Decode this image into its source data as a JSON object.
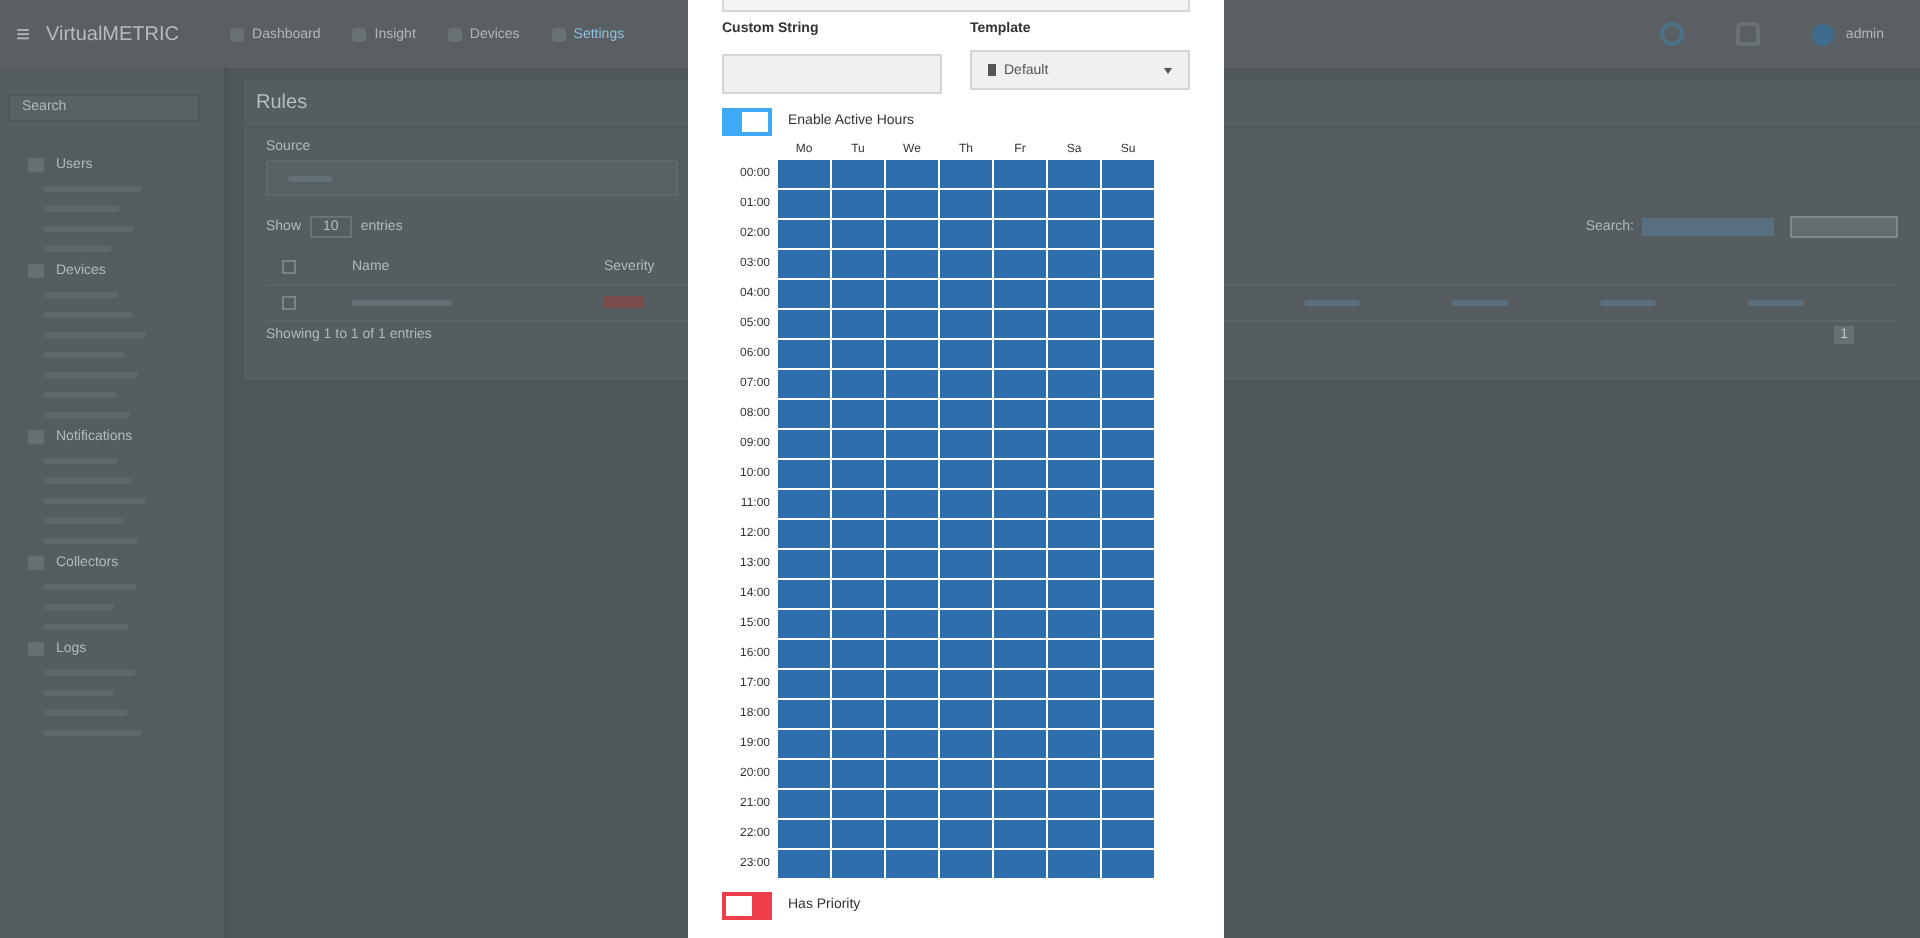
{
  "header": {
    "menu_glyph": "≡",
    "logo": "VirtualMETRIC",
    "nav": [
      {
        "label": "Dashboard",
        "selected": false
      },
      {
        "label": "Insight",
        "selected": false
      },
      {
        "label": "Devices",
        "selected": false
      },
      {
        "label": "Settings",
        "selected": true
      }
    ],
    "user": "admin"
  },
  "sidebar": {
    "search": {
      "placeholder": "Search"
    },
    "sections": [
      {
        "title": "Users"
      },
      {
        "title": "Devices"
      },
      {
        "title": "Notifications"
      },
      {
        "title": "Collectors"
      },
      {
        "title": "Logs"
      }
    ]
  },
  "page": {
    "title": "Rules",
    "source_label": "Source",
    "show_label": "Show",
    "show_value": "10",
    "entries_label": "entries",
    "columns": [
      "Name",
      "Severity"
    ],
    "select_all_checked": false,
    "row_checked": false,
    "info": "Showing 1 to 1 of 1 entries",
    "search_label": "Search:",
    "page_number": "1"
  },
  "modal": {
    "custom_string": {
      "label": "Custom String"
    },
    "template": {
      "label": "Template",
      "value": "Default"
    },
    "toggles_top": [
      {
        "label": "Enable Active Hours",
        "on": true
      }
    ],
    "active_hours": {
      "days": [
        "Mo",
        "Tu",
        "We",
        "Th",
        "Fr",
        "Sa",
        "Su"
      ],
      "hours": [
        {
          "time": "00:00",
          "active": [
            true,
            true,
            true,
            true,
            true,
            true,
            true
          ]
        },
        {
          "time": "01:00",
          "active": [
            true,
            true,
            true,
            true,
            true,
            true,
            true
          ]
        },
        {
          "time": "02:00",
          "active": [
            true,
            true,
            true,
            true,
            true,
            true,
            true
          ]
        },
        {
          "time": "03:00",
          "active": [
            true,
            true,
            true,
            true,
            true,
            true,
            true
          ]
        },
        {
          "time": "04:00",
          "active": [
            true,
            true,
            true,
            true,
            true,
            true,
            true
          ]
        },
        {
          "time": "05:00",
          "active": [
            true,
            true,
            true,
            true,
            true,
            true,
            true
          ]
        },
        {
          "time": "06:00",
          "active": [
            true,
            true,
            true,
            true,
            true,
            true,
            true
          ]
        },
        {
          "time": "07:00",
          "active": [
            true,
            true,
            true,
            true,
            true,
            true,
            true
          ]
        },
        {
          "time": "08:00",
          "active": [
            true,
            true,
            true,
            true,
            true,
            true,
            true
          ]
        },
        {
          "time": "09:00",
          "active": [
            true,
            true,
            true,
            true,
            true,
            true,
            true
          ]
        },
        {
          "time": "10:00",
          "active": [
            true,
            true,
            true,
            true,
            true,
            true,
            true
          ]
        },
        {
          "time": "11:00",
          "active": [
            true,
            true,
            true,
            true,
            true,
            true,
            true
          ]
        },
        {
          "time": "12:00",
          "active": [
            true,
            true,
            true,
            true,
            true,
            true,
            true
          ]
        },
        {
          "time": "13:00",
          "active": [
            true,
            true,
            true,
            true,
            true,
            true,
            true
          ]
        },
        {
          "time": "14:00",
          "active": [
            true,
            true,
            true,
            true,
            true,
            true,
            true
          ]
        },
        {
          "time": "15:00",
          "active": [
            true,
            true,
            true,
            true,
            true,
            true,
            true
          ]
        },
        {
          "time": "16:00",
          "active": [
            true,
            true,
            true,
            true,
            true,
            true,
            true
          ]
        },
        {
          "time": "17:00",
          "active": [
            true,
            true,
            true,
            true,
            true,
            true,
            true
          ]
        },
        {
          "time": "18:00",
          "active": [
            true,
            true,
            true,
            true,
            true,
            true,
            true
          ]
        },
        {
          "time": "19:00",
          "active": [
            true,
            true,
            true,
            true,
            true,
            true,
            true
          ]
        },
        {
          "time": "20:00",
          "active": [
            true,
            true,
            true,
            true,
            true,
            true,
            true
          ]
        },
        {
          "time": "21:00",
          "active": [
            true,
            true,
            true,
            true,
            true,
            true,
            true
          ]
        },
        {
          "time": "22:00",
          "active": [
            true,
            true,
            true,
            true,
            true,
            true,
            true
          ]
        },
        {
          "time": "23:00",
          "active": [
            true,
            true,
            true,
            true,
            true,
            true,
            true
          ]
        }
      ]
    },
    "toggles_bottom": [
      {
        "label": "Has Priority",
        "on": false
      }
    ]
  }
}
